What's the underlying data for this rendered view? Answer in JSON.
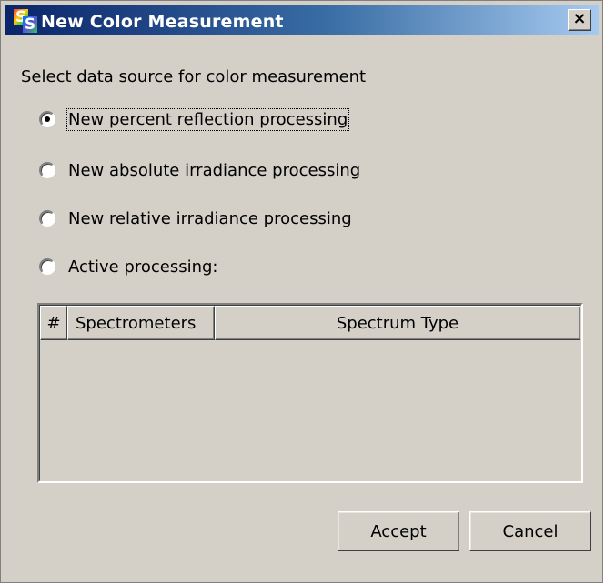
{
  "window": {
    "title": "New Color Measurement",
    "app_icon_letters": [
      "S",
      "S"
    ],
    "close_glyph": "×"
  },
  "prompt": "Select data source for color measurement",
  "options": [
    {
      "label": "New percent reflection processing",
      "selected": true
    },
    {
      "label": "New absolute irradiance processing",
      "selected": false
    },
    {
      "label": "New relative irradiance processing",
      "selected": false
    },
    {
      "label": "Active processing:",
      "selected": false
    }
  ],
  "table": {
    "columns": [
      "#",
      "Spectrometers",
      "Spectrum Type"
    ],
    "rows": []
  },
  "buttons": {
    "accept": "Accept",
    "cancel": "Cancel"
  },
  "colors": {
    "dialog_bg": "#d4d0c8",
    "title_start": "#0a246a",
    "title_end": "#a6caf0"
  }
}
